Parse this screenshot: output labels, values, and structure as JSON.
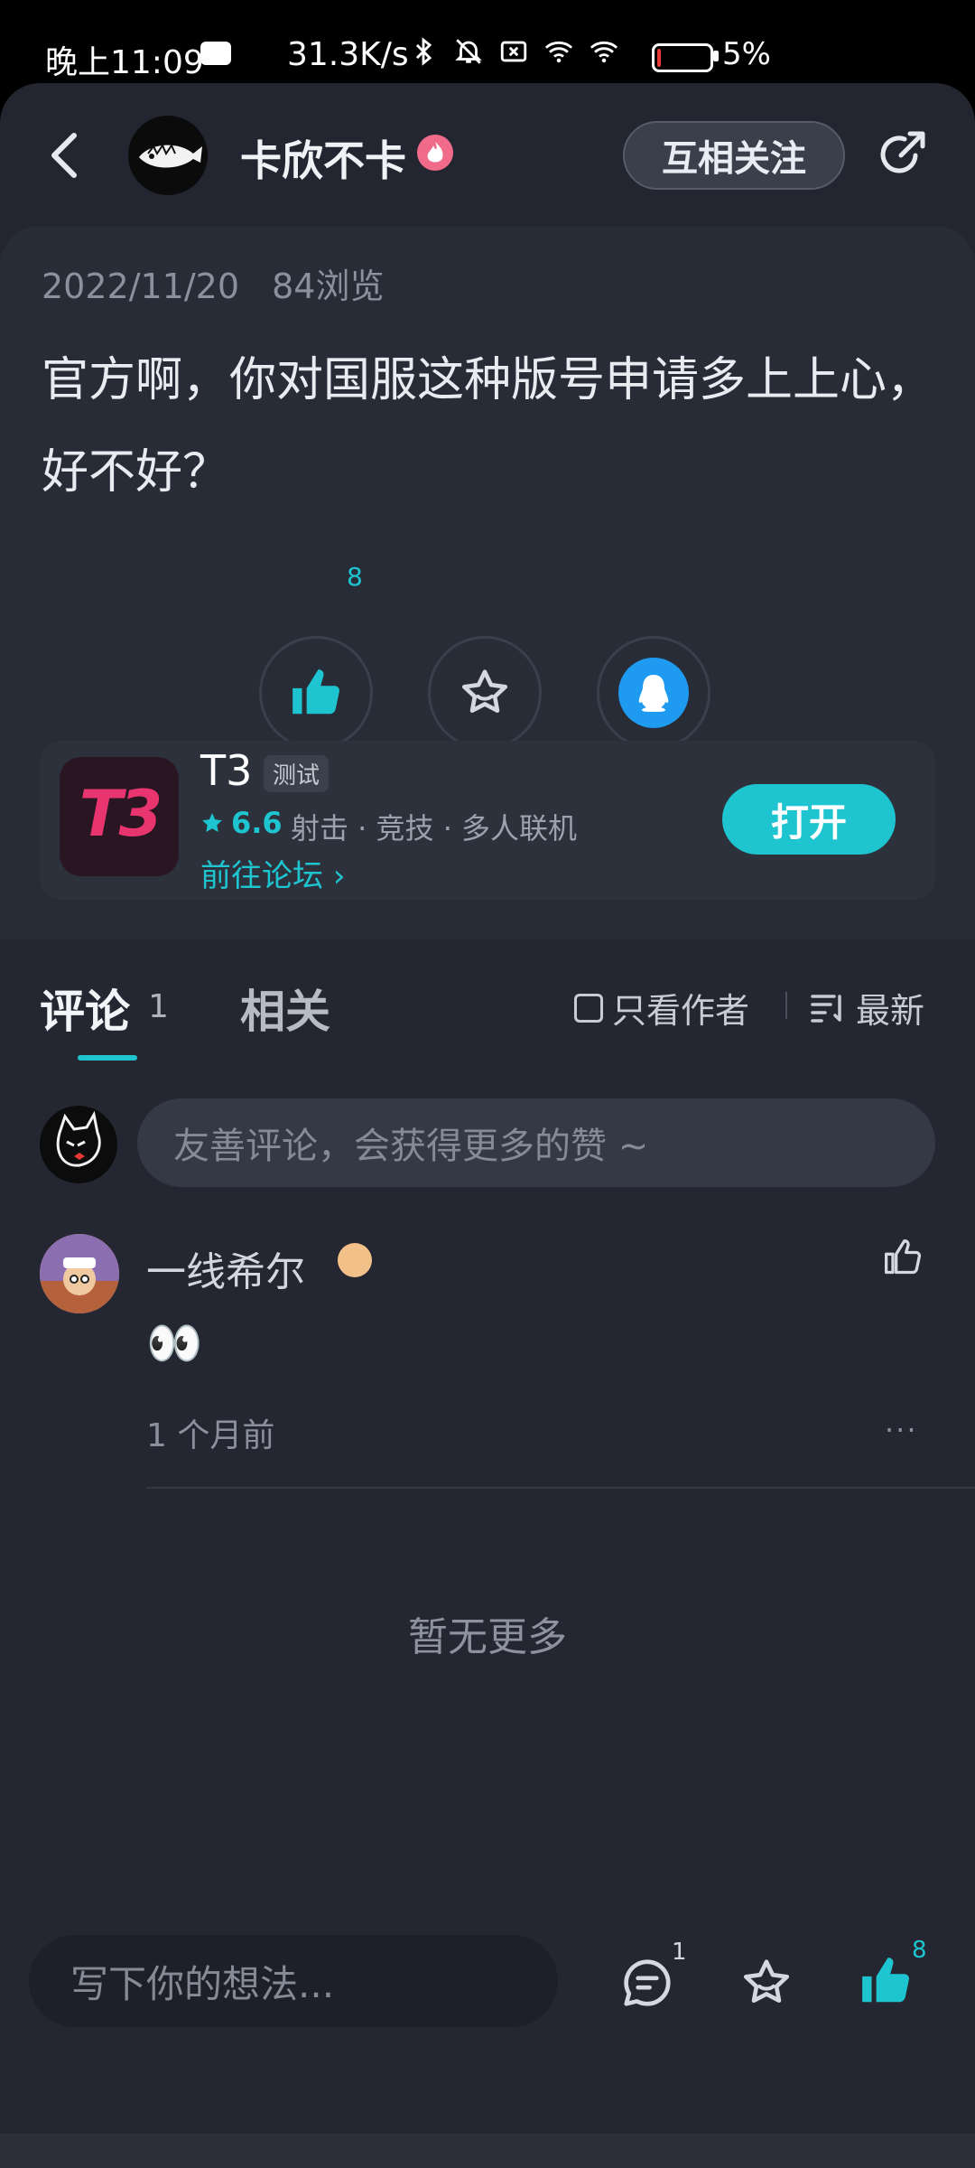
{
  "status_bar": {
    "time": "晚上11:09",
    "network_speed": "31.3K/s",
    "icons": [
      "cloud-icon",
      "bluetooth-icon",
      "mute-icon",
      "sim-off-icon",
      "wifi-icon",
      "wifi-icon-2"
    ],
    "battery_percent": "5%",
    "battery_level": 0.05
  },
  "header": {
    "author_name": "卡欣不卡",
    "follow_label": "互相关注",
    "icons": {
      "back": "chevron-left-icon",
      "share": "share-icon",
      "badge": "fire-badge-icon"
    }
  },
  "post": {
    "date": "2022/11/20",
    "views": "84浏览",
    "content": "官方啊，你对国服这种版号申请多上上心，好不好？",
    "like_count": "8",
    "actions": [
      "like-icon",
      "star-icon",
      "qq-share-icon"
    ]
  },
  "game_card": {
    "name": "T3",
    "tag": "测试",
    "rating": "6.6",
    "genres": "射击 · 竞技 · 多人联机",
    "forum_link": "前往论坛",
    "open_label": "打开",
    "icon_text": "T3"
  },
  "comments": {
    "tab_comment": "评论",
    "tab_comment_count": "1",
    "tab_related": "相关",
    "author_only_label": "只看作者",
    "sort_label": "最新",
    "input_placeholder": "友善评论，会获得更多的赞 ~",
    "items": [
      {
        "user": "一线希尔",
        "text": "👀",
        "time": "1 个月前",
        "more": "···"
      }
    ],
    "no_more": "暂无更多"
  },
  "bottom_bar": {
    "input_placeholder": "写下你的想法...",
    "comment_count": "1",
    "like_count": "8"
  },
  "colors": {
    "accent": "#1ec5d0",
    "background": "#232630",
    "card": "#282c37",
    "game_icon_pink": "#e8356f"
  }
}
